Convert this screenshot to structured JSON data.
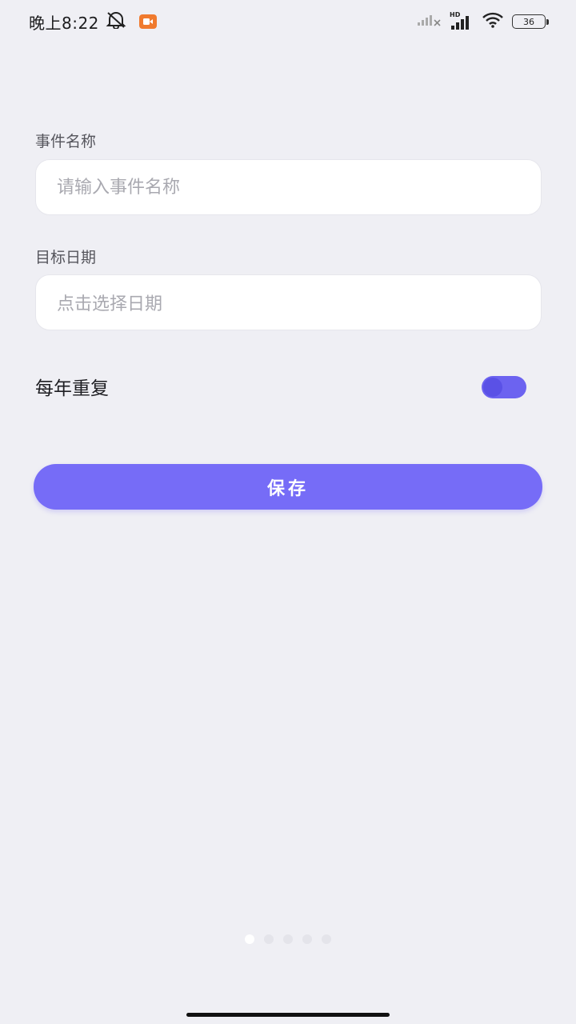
{
  "status_bar": {
    "time": "晚上8:22",
    "battery_level": "36",
    "network_badge": "HD",
    "icons": [
      "bell-off-icon",
      "screen-record-icon",
      "signal-weak-icon",
      "signal-strong-icon",
      "wifi-icon",
      "battery-icon"
    ]
  },
  "form": {
    "event_name": {
      "label": "事件名称",
      "placeholder": "请输入事件名称",
      "value": ""
    },
    "target_date": {
      "label": "目标日期",
      "placeholder": "点击选择日期"
    },
    "repeat_yearly": {
      "label": "每年重复",
      "enabled": true
    },
    "save_label": "保存"
  },
  "pager": {
    "count": 5,
    "active_index": 0
  },
  "colors": {
    "background": "#efeff4",
    "accent": "#766cf7",
    "toggle_on": "#6c63f0",
    "record_badge": "#f07a2e"
  }
}
